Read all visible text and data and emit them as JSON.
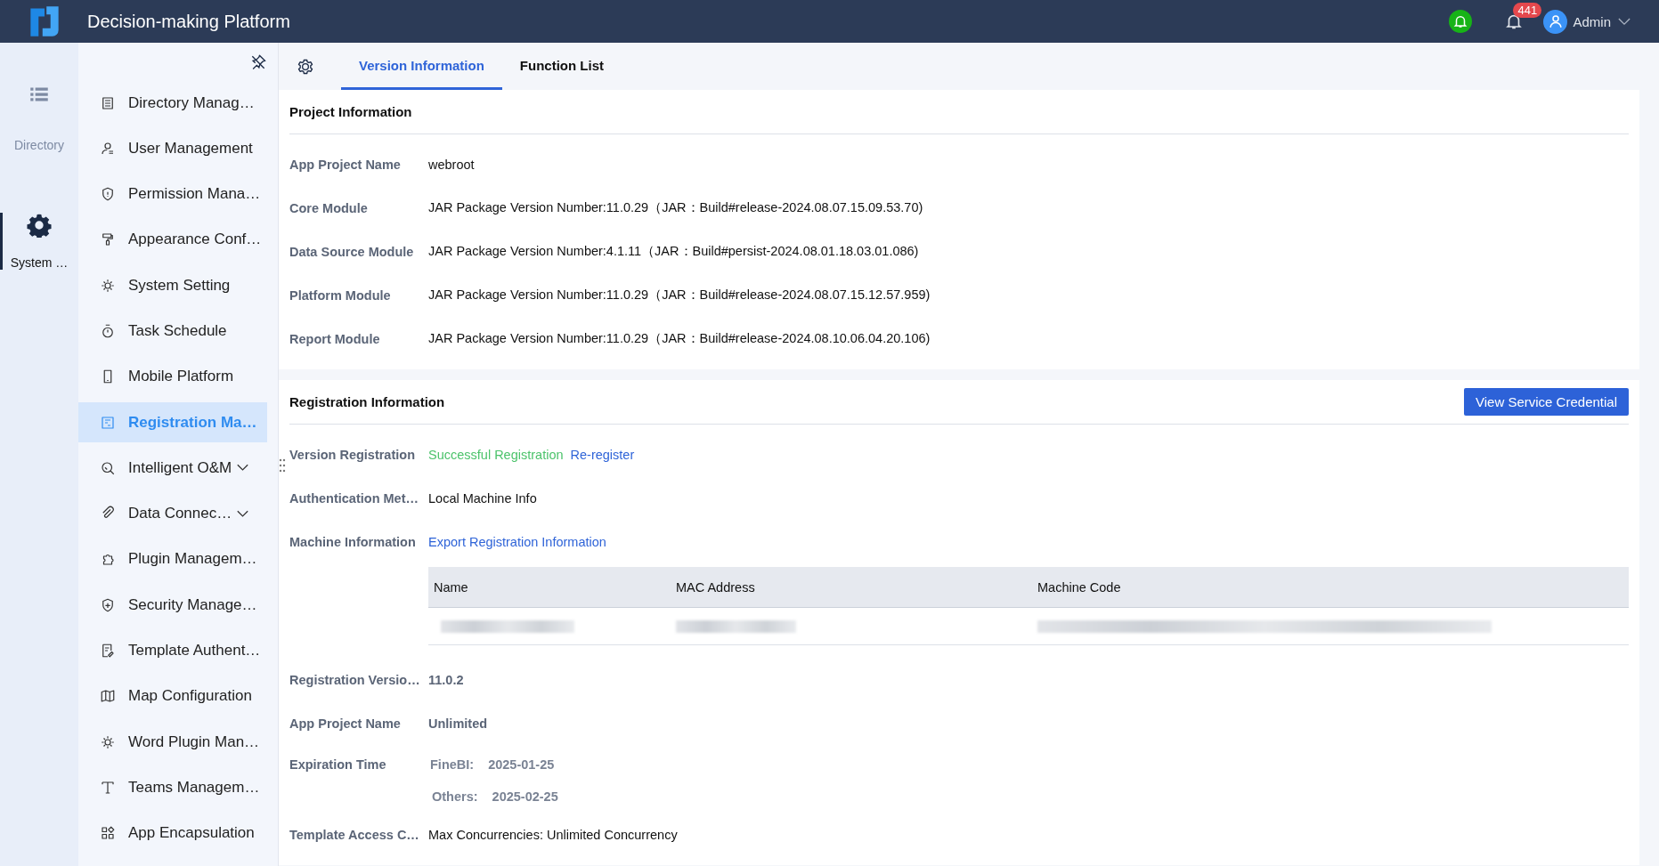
{
  "header": {
    "title": "Decision-making Platform",
    "notification_count": "441",
    "user": "Admin"
  },
  "rail": [
    {
      "label": "Directory",
      "selected": false
    },
    {
      "label": "System …",
      "selected": true
    }
  ],
  "sidebar": {
    "items": [
      {
        "label": "Directory Manag…",
        "selected": false,
        "expandable": false
      },
      {
        "label": "User Management",
        "selected": false,
        "expandable": false
      },
      {
        "label": "Permission Mana…",
        "selected": false,
        "expandable": false
      },
      {
        "label": "Appearance Conf…",
        "selected": false,
        "expandable": false
      },
      {
        "label": "System Setting",
        "selected": false,
        "expandable": false
      },
      {
        "label": "Task Schedule",
        "selected": false,
        "expandable": false
      },
      {
        "label": "Mobile Platform",
        "selected": false,
        "expandable": false
      },
      {
        "label": "Registration Ma…",
        "selected": true,
        "expandable": false
      },
      {
        "label": "Intelligent O&M",
        "selected": false,
        "expandable": true
      },
      {
        "label": "Data Connec…",
        "selected": false,
        "expandable": true
      },
      {
        "label": "Plugin Managem…",
        "selected": false,
        "expandable": false
      },
      {
        "label": "Security Manage…",
        "selected": false,
        "expandable": false
      },
      {
        "label": "Template Authent…",
        "selected": false,
        "expandable": false
      },
      {
        "label": "Map Configuration",
        "selected": false,
        "expandable": false
      },
      {
        "label": "Word Plugin Man…",
        "selected": false,
        "expandable": false
      },
      {
        "label": "Teams Managem…",
        "selected": false,
        "expandable": false
      },
      {
        "label": "App Encapsulation",
        "selected": false,
        "expandable": false
      }
    ]
  },
  "tabs": [
    {
      "label": "Version Information",
      "selected": true
    },
    {
      "label": "Function List",
      "selected": false
    }
  ],
  "project_information": {
    "title": "Project Information",
    "rows": [
      {
        "label": "App Project Name",
        "value": "webroot"
      },
      {
        "label": "Core Module",
        "value": "JAR Package Version Number:11.0.29（JAR：Build#release-2024.08.07.15.09.53.70)"
      },
      {
        "label": "Data Source Module",
        "value": "JAR Package Version Number:4.1.11（JAR：Build#persist-2024.08.01.18.03.01.086)"
      },
      {
        "label": "Platform Module",
        "value": "JAR Package Version Number:11.0.29（JAR：Build#release-2024.08.07.15.12.57.959)"
      },
      {
        "label": "Report Module",
        "value": "JAR Package Version Number:11.0.29（JAR：Build#release-2024.08.10.06.04.20.106)"
      }
    ]
  },
  "registration_information": {
    "title": "Registration Information",
    "button": "View Service Credential",
    "rows": [
      {
        "kind": "status",
        "label": "Version Registration",
        "status": "Successful Registration",
        "link": "Re-register"
      },
      {
        "kind": "text",
        "label": "Authentication Met…",
        "value": "Local Machine Info"
      },
      {
        "kind": "link",
        "label": "Machine Information",
        "value": "Export Registration Information"
      },
      {
        "kind": "table",
        "columns": [
          "Name",
          "MAC Address",
          "Machine Code"
        ]
      },
      {
        "kind": "strong",
        "label": "Registration Versio…",
        "value": "11.0.2"
      },
      {
        "kind": "strong",
        "label": "App Project Name",
        "value": "Unlimited"
      },
      {
        "kind": "expiry",
        "label": "Expiration Time",
        "entries": [
          {
            "name": "FineBI:",
            "date": "2025-01-25"
          },
          {
            "name": "Others:",
            "date": "2025-02-25"
          }
        ]
      },
      {
        "kind": "text",
        "label": "Template Access C…",
        "value": "Max Concurrencies: Unlimited Concurrency"
      }
    ]
  }
}
